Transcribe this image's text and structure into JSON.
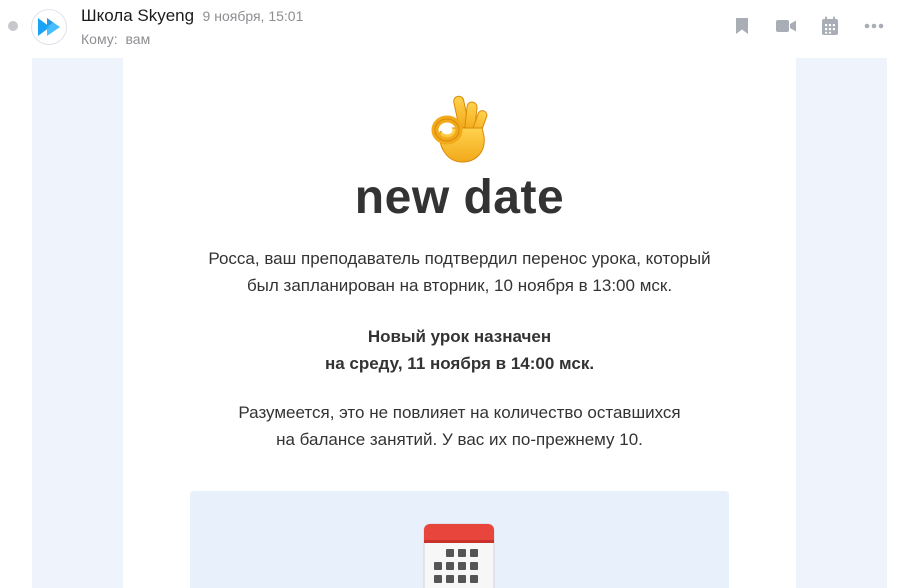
{
  "header": {
    "sender_name": "Школа Skyeng",
    "date": "9 ноября, 15:01",
    "recipient_label": "Кому:",
    "recipient_value": "вам"
  },
  "toolbar": {
    "bookmark_icon": "bookmark-icon",
    "video_icon": "video-icon",
    "calendar_icon": "calendar-icon",
    "more_icon": "more-icon"
  },
  "email": {
    "headline": "new date",
    "paragraph1": [
      "Росса, ваш преподаватель подтвердил перенос урока, который",
      "был запланирован на вторник, 10 ноября в 13:00 мск."
    ],
    "paragraph2": [
      "Новый урок назначен",
      "на среду, 11 ноября в 14:00 мск."
    ],
    "paragraph3": [
      "Разумеется, это не повлияет на количество оставшихся",
      "на балансе занятий. У вас их по-прежнему 10."
    ]
  },
  "colors": {
    "text": "#333333",
    "muted": "#8e8e93",
    "icon": "#a9adb5",
    "brand_blue": "#1aa3f5",
    "mail_bg": "#eff3fb",
    "info_box_bg": "#e8f0fc"
  }
}
